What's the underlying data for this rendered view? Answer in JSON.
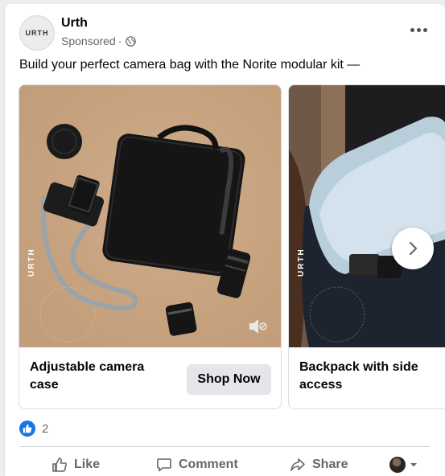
{
  "post": {
    "page_name": "Urth",
    "avatar_text": "URTH",
    "sponsored_label": "Sponsored",
    "separator": "·",
    "caption": "Build your perfect camera bag with the Norite modular kit —"
  },
  "carousel": {
    "cards": [
      {
        "title": "Adjustable camera case",
        "cta": "Shop Now",
        "watermark": "URTH"
      },
      {
        "title": "Backpack with side access",
        "watermark": "URTH"
      }
    ]
  },
  "reactions": {
    "count": "2"
  },
  "actions": {
    "like": "Like",
    "comment": "Comment",
    "share": "Share"
  },
  "colors": {
    "accent_blue": "#1b74e4",
    "muted_text": "#65676b",
    "button_gray": "#e4e6eb",
    "product_bg": "#c9a583"
  },
  "icons": [
    "globe-icon",
    "more-options-icon",
    "chevron-right-icon",
    "mute-icon",
    "like-icon",
    "comment-icon",
    "share-icon",
    "chevron-down-icon"
  ]
}
